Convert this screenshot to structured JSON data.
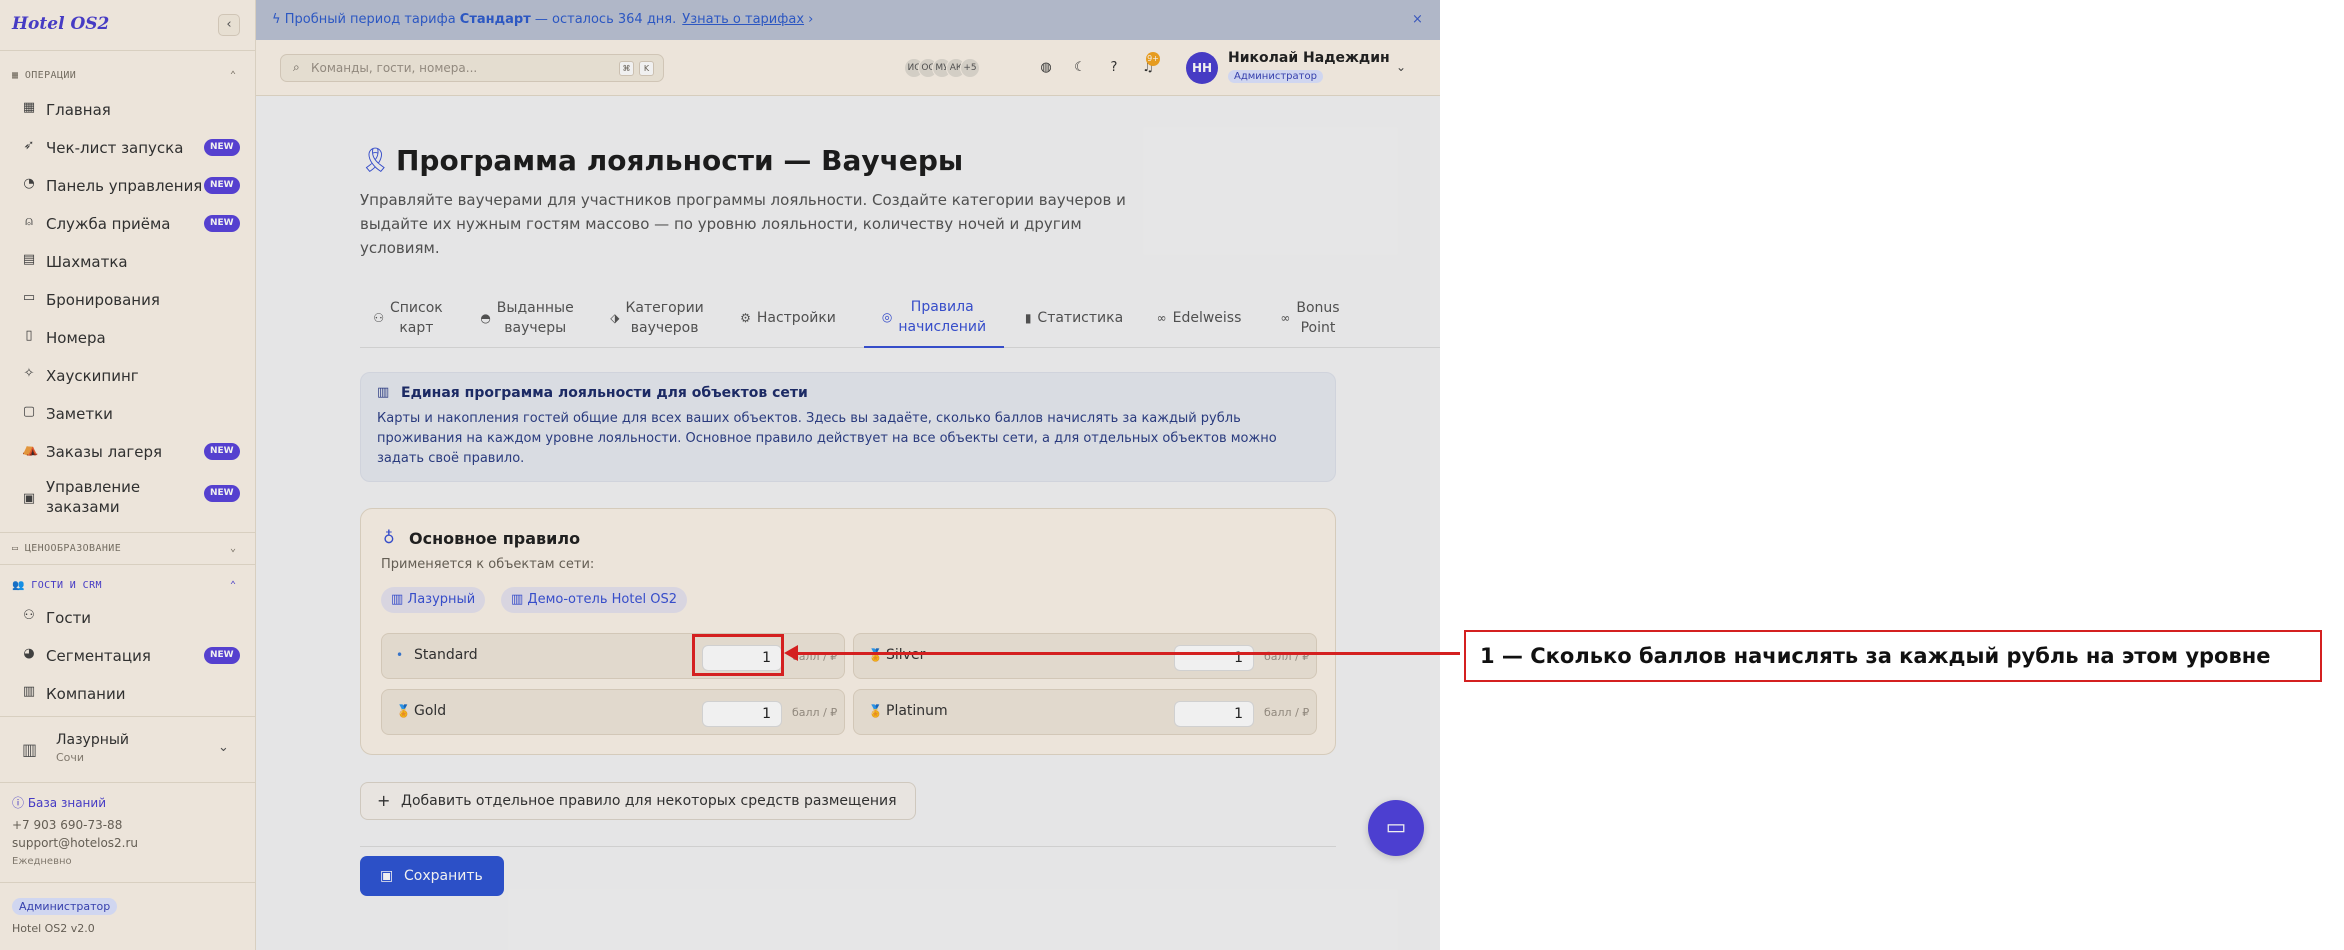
{
  "sidebar": {
    "brand": "Hotel OS2",
    "sections": {
      "operations": "ОПЕРАЦИИ",
      "pricing": "ЦЕНООБРАЗОВАНИЕ",
      "guests_crm": "ГОСТИ И CRM"
    },
    "items": [
      {
        "label": "Главная",
        "icon": "grid-icon"
      },
      {
        "label": "Чек-лист запуска",
        "icon": "rocket-icon",
        "badge": "NEW"
      },
      {
        "label": "Панель управления",
        "icon": "gauge-icon",
        "badge": "NEW"
      },
      {
        "label": "Служба приёма",
        "icon": "bell-icon",
        "badge": "NEW"
      },
      {
        "label": "Шахматка",
        "icon": "table-icon"
      },
      {
        "label": "Бронирования",
        "icon": "book-icon"
      },
      {
        "label": "Номера",
        "icon": "door-icon"
      },
      {
        "label": "Хаускипинг",
        "icon": "sparkle-icon"
      },
      {
        "label": "Заметки",
        "icon": "note-icon"
      },
      {
        "label": "Заказы лагеря",
        "icon": "tent-icon",
        "badge": "NEW"
      },
      {
        "label": "Управление",
        "label2": "заказами",
        "icon": "clipboard-icon",
        "badge": "NEW"
      },
      {
        "label": "Гости",
        "icon": "users-icon"
      },
      {
        "label": "Сегментация",
        "icon": "pie-icon",
        "badge": "NEW"
      },
      {
        "label": "Компании",
        "icon": "building-icon"
      }
    ],
    "hotel": {
      "name": "Лазурный",
      "city": "Сочи"
    },
    "knowledge_base": "База знаний",
    "phone": "+7 903 690-73-88",
    "email": "support@hotelos2.ru",
    "schedule": "Ежедневно",
    "role": "Администратор",
    "version": "Hotel OS2 v2.0"
  },
  "banner": {
    "text_a": "Пробный период тарифа",
    "plan": "Стандарт",
    "text_b": "— осталось 364 дня.",
    "link": "Узнать о тарифах",
    "close": "×"
  },
  "topbar": {
    "search_placeholder": "Команды, гости, номера...",
    "kbd1": "⌘",
    "kbd2": "K",
    "avatars": [
      "ИС",
      "ОС",
      "МУ",
      "АК"
    ],
    "more_avatars": "+5",
    "bell_count": "9+",
    "user_initials": "НН",
    "user_name": "Николай Надеждин",
    "user_role": "Администратор"
  },
  "page": {
    "title": "Программа лояльности — Ваучеры",
    "subtitle": "Управляйте ваучерами для участников программы лояльности. Создайте категории ваучеров и выдайте их нужным гостям массово — по уровню лояльности, количеству ночей и другим условиям."
  },
  "tabs": [
    {
      "l1": "Список",
      "l2": "карт"
    },
    {
      "l1": "Выданные",
      "l2": "ваучеры"
    },
    {
      "l1": "Категории",
      "l2": "ваучеров"
    },
    {
      "l1": "Настройки",
      "l2": ""
    },
    {
      "l1": "Правила",
      "l2": "начислений"
    },
    {
      "l1": "Статистика",
      "l2": ""
    },
    {
      "l1": "Edelweiss",
      "l2": ""
    },
    {
      "l1": "Bonus",
      "l2": "Point"
    }
  ],
  "info": {
    "title": "Единая программа лояльности для объектов сети",
    "body": "Карты и накопления гостей общие для всех ваших объектов. Здесь вы задаёте, сколько баллов начислять за каждый рубль проживания на каждом уровне лояльности. Основное правило действует на все объекты сети, а для отдельных объектов можно задать своё правило."
  },
  "rule": {
    "title": "Основное правило",
    "subtitle": "Применяется к объектам сети:",
    "chips": [
      "Лазурный",
      "Демо-отель Hotel OS2"
    ],
    "unit": "балл / ₽",
    "levels": [
      {
        "name": "Standard",
        "value": "1",
        "icon": "dot-icon"
      },
      {
        "name": "Silver",
        "value": "1",
        "icon": "medal-icon"
      },
      {
        "name": "Gold",
        "value": "1",
        "icon": "medal-icon"
      },
      {
        "name": "Platinum",
        "value": "1",
        "icon": "medal-icon"
      }
    ]
  },
  "add_rule": "Добавить отдельное правило для некоторых средств размещения",
  "save": "Сохранить",
  "annotation": {
    "text": "1 — Сколько баллов начислять за каждый рубль на этом уровне",
    "color": "#d42020"
  },
  "colors": {
    "accent": "#4b3fd1",
    "primary": "#2f55d4",
    "sidebar_bg": "#fbf3e8"
  }
}
